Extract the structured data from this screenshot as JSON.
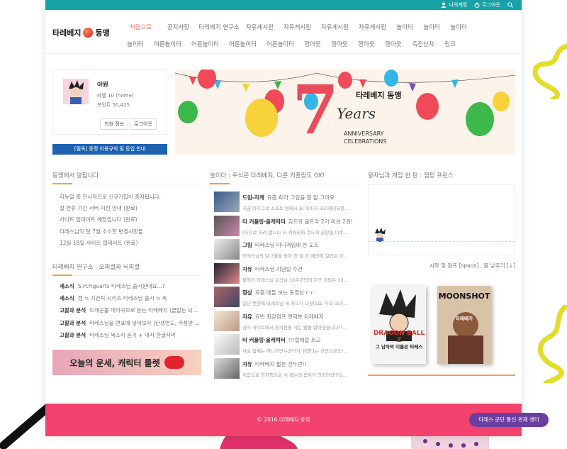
{
  "topbar": {
    "mypage": "나의계정",
    "logout": "로그아웃"
  },
  "logo": {
    "left": "타레베지",
    "right": "동맹"
  },
  "nav": [
    "처음으로",
    "공지사항",
    "타레베지 연구소",
    "자유게시판",
    "자유게시판",
    "자유게시판",
    "자유게시판",
    "놀이터",
    "놀이터",
    "놀이터",
    "놀이터",
    "어른놀이터",
    "어른놀이터",
    "어른놀이터",
    "어른놀이터",
    "행아웃",
    "행아웃",
    "행아웃",
    "행아웃",
    "축전상자",
    "링크"
  ],
  "profile": {
    "name": "야원",
    "level": "레벨 10 (home)",
    "points": "포인트 50,425",
    "info_btn": "회원 정보",
    "logout_btn": "로그아웃"
  },
  "rules_button": "[필독] 동맹 이용규칙 및 등업 안내",
  "banner": {
    "number": "7",
    "years": "Years",
    "brand": "타레베지 동맹",
    "line1": "ANNIVERSARY",
    "line2": "CELEBRATIONS"
  },
  "notice": {
    "title": "동맹에서 알립니다",
    "items": [
      "리뉴얼 중 한시적으로 신규가입이 중지됩니다.",
      "설 연휴 기간 서버 이전 안내 (완료)",
      "사이트 업데이트 예정입니다 (완료)",
      "타레스님의 달 7월 소소한 변경사항들",
      "12월 18일 사이트 업데이트 (완료)"
    ]
  },
  "research": {
    "title": "타레베지 연구소 : 오피셜과 뇌피셜",
    "items": [
      {
        "cat": "새소식",
        "text": "S.H.Figuarts 타레스님 출시된대요...?"
      },
      {
        "cat": "새소식",
        "text": "겜 ≒ 기간틱 시리즈 타레스님 출시 ≒ 축"
      },
      {
        "cat": "고찰과 분석",
        "text": "드래곤볼 데마곡으로 듣는 타레베지 (끝없는 뇌..."
      },
      {
        "cat": "고찰과 분석",
        "text": "타레스님을 연표에 넣어보자 (탄생연도, 극장판 ..."
      },
      {
        "cat": "고찰과 분석",
        "text": "타레스님 목소리 듣기 + 대사 한글자막"
      }
    ]
  },
  "fortune": "오늘의 운세, 캐릭터 룰렛",
  "forum": {
    "title": "놀이터 : 주식은 타레베지, 다른 커플링도 OK!",
    "items": [
      {
        "cat": "드림-자캐",
        "title": "요즘 AI가 그림을 참 잘 그려요",
        "sub": "지금 아이그로 소프트 빙에서 AI 이미지 크리에이터를..."
      },
      {
        "cat": "타 커플링·올캐릭터",
        "title": "츄드와 울트라 2기 미션 2권!",
        "sub": "(자유로 하려 했으나 타 캐릭터와 슈드의 끝장을 다수..."
      },
      {
        "cat": "그림",
        "title": "타레스님 미니게임에 쓴 도트",
        "sub": "타레스님의 달 7월을 맞아 한 달 간 메인에 걸었던 미..."
      },
      {
        "cat": "자유",
        "title": "타레스님 기념일 수건",
        "sub": "올해가 타레스님 오산날 33주년인데 지구 강림은 33..."
      },
      {
        "cat": "영상",
        "title": "요즘 애들 보는 동영상ㅜㅜ",
        "sub": "일단 뭇찬에 타레스님 새 카드가 나왔대요. 우리 크리..."
      },
      {
        "cat": "자유",
        "title": "요번 최강점프 연재분 타레베지",
        "sub": "공식 사이트에서 전자판을 사는 법을 알아냈습니다!!..."
      },
      {
        "cat": "타 커플링·올캐릭터",
        "title": "!!!합체합 최고",
        "sub": "사실 합체는 아니지만누군가가 섞였다는 것만으로도!..."
      },
      {
        "cat": "자유",
        "title": "타레베지 짧은 전두번!!",
        "sub": "처음으로 전자책으로 사 봤는데 캡처가 안되더라구요..."
      }
    ]
  },
  "game": {
    "title": "왕자님과 게임 한 판 : 점핑 프린스",
    "caption": "시작 및 점프 [space] , 몸 낮추기 [↓]"
  },
  "books": [
    {
      "title": "DRAGON BALL Z",
      "subtitle": "그 남자의 이름은 타레스"
    },
    {
      "title": "MOONSHOT",
      "subtitle": "타레베지"
    }
  ],
  "footer": "© 2016 타레베지 동맹",
  "chat_button": "타레스 군단 통신 관제 센터",
  "colors": {
    "topbar": "#17a2a6",
    "footer": "#f3426d",
    "accent": "#f5a040",
    "rules_button": "#1e62b1",
    "chat_button": "#6b3fa0"
  }
}
